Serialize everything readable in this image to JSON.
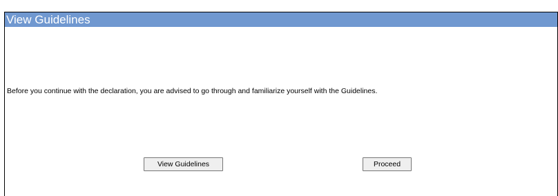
{
  "header": {
    "title": "View Guidelines"
  },
  "main": {
    "message": "Before you continue with the declaration, you are advised to go through and familiarize yourself with the Guidelines.",
    "buttons": {
      "view_guidelines_label": "View Guidelines",
      "proceed_label": "Proceed"
    }
  },
  "colors": {
    "title_bar": "#7098d0",
    "title_text": "#ffffff"
  }
}
